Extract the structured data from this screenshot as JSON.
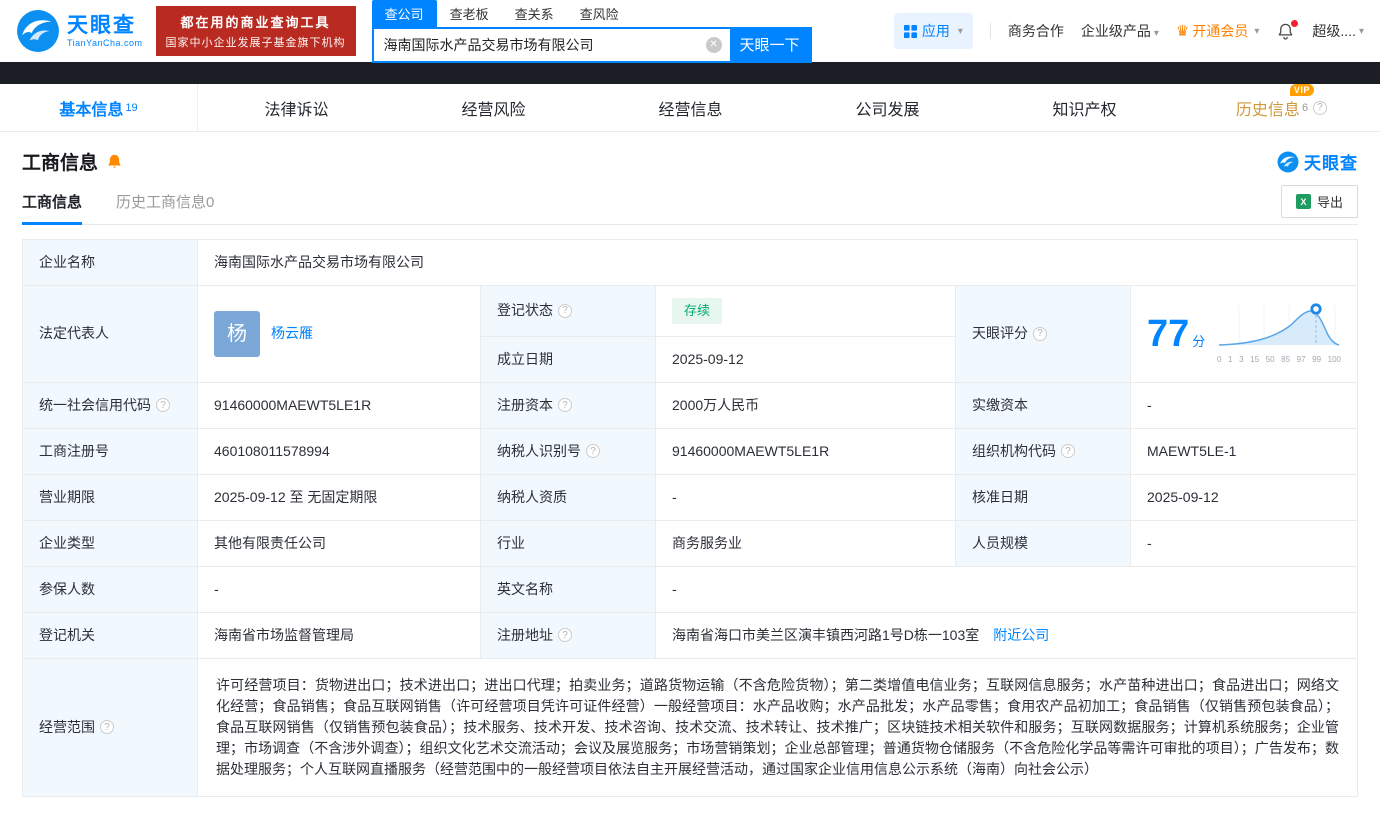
{
  "header": {
    "logo": {
      "title": "天眼查",
      "subtitle": "TianYanCha.com"
    },
    "badge": {
      "line1": "都在用的商业查询工具",
      "line2": "国家中小企业发展子基金旗下机构"
    },
    "search": {
      "tabs": [
        {
          "label": "查公司"
        },
        {
          "label": "查老板"
        },
        {
          "label": "查关系"
        },
        {
          "label": "查风险"
        }
      ],
      "value": "海南国际水产品交易市场有限公司",
      "button": "天眼一下"
    },
    "nav": {
      "app": "应用",
      "coop": "商务合作",
      "enterprise": "企业级产品",
      "vip": "开通会员",
      "super": "超级...."
    }
  },
  "tabs": [
    {
      "label": "基本信息",
      "count": "19"
    },
    {
      "label": "法律诉讼"
    },
    {
      "label": "经营风险"
    },
    {
      "label": "经营信息"
    },
    {
      "label": "公司发展"
    },
    {
      "label": "知识产权"
    },
    {
      "label": "历史信息",
      "count": "6",
      "vip_label": "VIP"
    }
  ],
  "section": {
    "title": "工商信息",
    "brand": "天眼查",
    "subtabs": [
      {
        "label": "工商信息"
      },
      {
        "label": "历史工商信息0"
      }
    ],
    "export": "导出"
  },
  "table": {
    "company_name_label": "企业名称",
    "company_name": "海南国际水产品交易市场有限公司",
    "legal_rep_label": "法定代表人",
    "legal_rep_avatar": "杨",
    "legal_rep": "杨云雁",
    "reg_status_label": "登记状态",
    "reg_status": "存续",
    "score_label": "天眼评分",
    "score": "77",
    "score_unit": "分",
    "score_axis": [
      "0",
      "1",
      "3",
      "15",
      "50",
      "85",
      "97",
      "99",
      "100"
    ],
    "established_label": "成立日期",
    "established": "2025-09-12",
    "credit_code_label": "统一社会信用代码",
    "credit_code": "91460000MAEWT5LE1R",
    "reg_capital_label": "注册资本",
    "reg_capital": "2000万人民币",
    "paid_capital_label": "实缴资本",
    "paid_capital": "-",
    "reg_number_label": "工商注册号",
    "reg_number": "460108011578994",
    "taxpayer_id_label": "纳税人识别号",
    "taxpayer_id": "91460000MAEWT5LE1R",
    "org_code_label": "组织机构代码",
    "org_code": "MAEWT5LE-1",
    "business_term_label": "营业期限",
    "business_term": "2025-09-12 至 无固定期限",
    "taxpayer_quality_label": "纳税人资质",
    "taxpayer_quality": "-",
    "approval_date_label": "核准日期",
    "approval_date": "2025-09-12",
    "company_type_label": "企业类型",
    "company_type": "其他有限责任公司",
    "industry_label": "行业",
    "industry": "商务服务业",
    "staff_size_label": "人员规模",
    "staff_size": "-",
    "insured_label": "参保人数",
    "insured": "-",
    "english_name_label": "英文名称",
    "english_name": "-",
    "reg_authority_label": "登记机关",
    "reg_authority": "海南省市场监督管理局",
    "address_label": "注册地址",
    "address": "海南省海口市美兰区演丰镇西河路1号D栋一103室",
    "nearby": "附近公司",
    "scope_label": "经营范围",
    "scope": "许可经营项目：货物进出口；技术进出口；进出口代理；拍卖业务；道路货物运输（不含危险货物）；第二类增值电信业务；互联网信息服务；水产苗种进出口；食品进出口；网络文化经营；食品销售；食品互联网销售（许可经营项目凭许可证件经营）一般经营项目：水产品收购；水产品批发；水产品零售；食用农产品初加工；食品销售（仅销售预包装食品）；食品互联网销售（仅销售预包装食品）；技术服务、技术开发、技术咨询、技术交流、技术转让、技术推广；区块链技术相关软件和服务；互联网数据服务；计算机系统服务；企业管理；市场调查（不含涉外调查）；组织文化艺术交流活动；会议及展览服务；市场营销策划；企业总部管理；普通货物仓储服务（不含危险化学品等需许可审批的项目）；广告发布；数据处理服务；个人互联网直播服务（经营范围中的一般经营项目依法自主开展经营活动，通过国家企业信用信息公示系统（海南）向社会公示）"
  }
}
